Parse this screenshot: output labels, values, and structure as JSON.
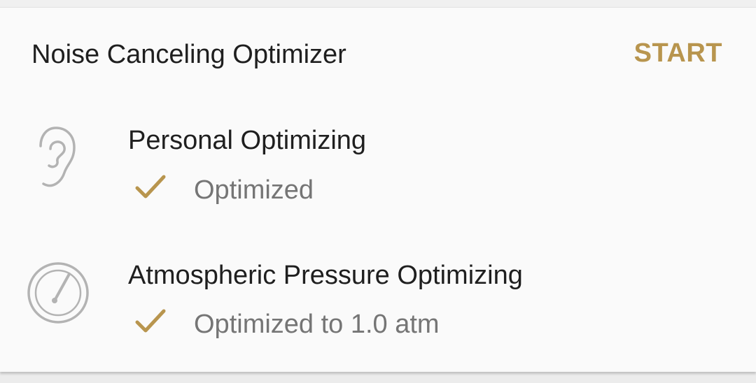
{
  "card": {
    "title": "Noise Canceling Optimizer",
    "action_label": "START"
  },
  "rows": [
    {
      "icon": "ear-icon",
      "title": "Personal Optimizing",
      "status_icon": "check-icon",
      "status": "Optimized"
    },
    {
      "icon": "gauge-icon",
      "title": "Atmospheric Pressure Optimizing",
      "status_icon": "check-icon",
      "status": "Optimized to 1.0 atm"
    }
  ],
  "colors": {
    "accent": "#b8954e",
    "text_primary": "#1f1f1f",
    "text_secondary": "#757575",
    "icon_gray": "#b3b3b3",
    "card_background": "#fafafa"
  }
}
